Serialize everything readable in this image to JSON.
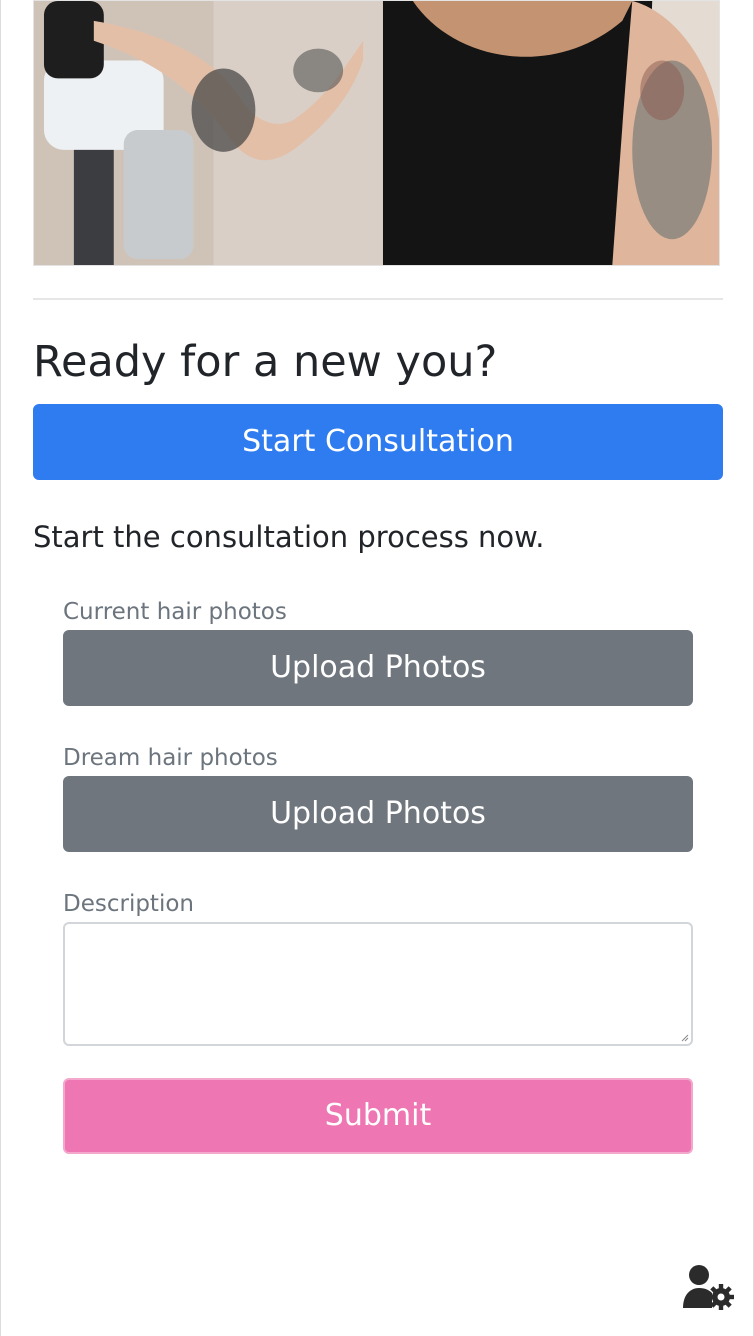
{
  "colors": {
    "primary": "#2f7bf0",
    "secondary": "#6f767e",
    "submit": "#ee76b2",
    "text": "#212529",
    "muted": "#6c757d"
  },
  "hero": {
    "image": "Photo of a stylist with tattooed arms holding a hair dryer"
  },
  "heading": "Ready for a new you?",
  "start_button": "Start Consultation",
  "lead_text": "Start the consultation process now.",
  "form": {
    "current_label": "Current hair photos",
    "current_button": "Upload Photos",
    "dream_label": "Dream hair photos",
    "dream_button": "Upload Photos",
    "description_label": "Description",
    "description_value": "",
    "submit_button": "Submit"
  },
  "icons": {
    "user_settings": "user-gear-icon"
  }
}
